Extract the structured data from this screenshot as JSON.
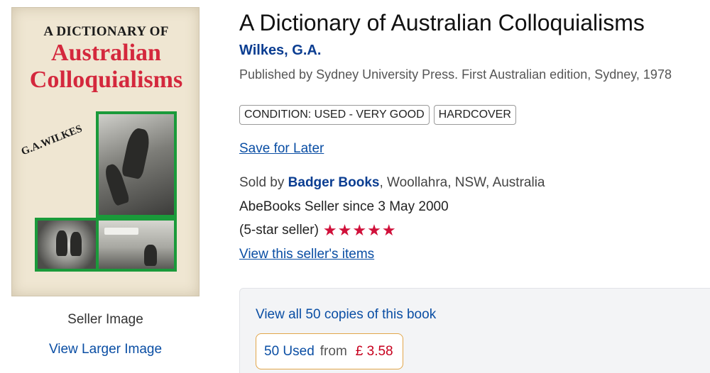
{
  "cover": {
    "line1": "A DICTIONARY OF",
    "line2": "Australian",
    "line3": "Colloquialisms",
    "author": "G.A.WILKES",
    "caption": "Seller Image",
    "view_larger": "View Larger Image"
  },
  "book": {
    "title": "A Dictionary of Australian Colloquialisms",
    "author": "Wilkes, G.A.",
    "publisher": "Published by Sydney University Press. First Australian edition, Sydney, 1978"
  },
  "badges": [
    "CONDITION: USED - VERY GOOD",
    "HARDCOVER"
  ],
  "actions": {
    "save_for_later": "Save for Later",
    "view_seller_items": "View this seller's items"
  },
  "seller": {
    "sold_by_prefix": "Sold by ",
    "name": "Badger Books",
    "location": ", Woollahra, NSW, Australia",
    "since": "AbeBooks Seller since 3 May 2000",
    "rating_text": "(5-star seller)",
    "stars": 5,
    "star_color": "#d0103a"
  },
  "copies": {
    "view_all": "View all 50 copies of this book",
    "used_count": "50 Used",
    "from_label": "from",
    "price": "£ 3.58"
  },
  "colors": {
    "link": "#0a4ea4",
    "author": "#0a3d91",
    "price": "#c7001e",
    "price_border": "#e2a64a"
  }
}
